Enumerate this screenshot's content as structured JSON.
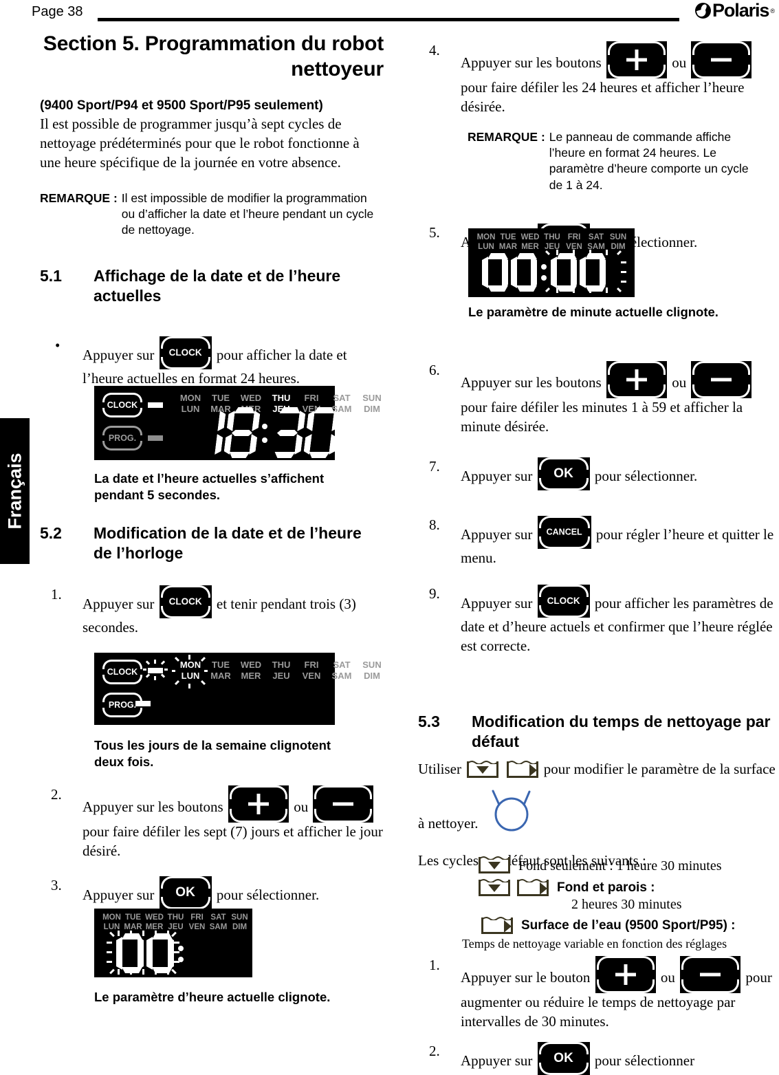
{
  "header": {
    "page_label": "Page 38",
    "brand": "Polaris",
    "brand_reg": "®"
  },
  "side_tab": {
    "label": "Français"
  },
  "left_column": {
    "section_title": "Section 5. Programmation du robot nettoyeur",
    "models_note": "(9400 Sport/P94 et 9500 Sport/P95 seulement)",
    "intro": "Il est possible de programmer jusqu’à sept cycles de nettoyage prédéterminés pour que le robot fonctionne à une heure spécifique de la journée en votre absence.",
    "remark_label": "REMARQUE :",
    "remark_body": "Il est impossible de modifier la programmation ou d’afficher la date et l’heure pendant un cycle de nettoyage.",
    "s51": {
      "number": "5.1",
      "title": "Affichage de la date et de l’heure actuelles",
      "bullet": "•",
      "step_a": "Appuyer sur",
      "step_b": "pour afficher la date et l’heure actuelles en format 24 heures.",
      "caption": "La date et l’heure actuelles s’affichent pendant 5 secondes."
    },
    "s52": {
      "number": "5.2",
      "title": "Modification de la date et de l’heure de l’horloge",
      "step1_num": "1.",
      "step1_a": "Appuyer sur",
      "step1_b": "et tenir pendant trois (3) secondes.",
      "caption1": "Tous les jours de la semaine clignotent deux fois.",
      "step2_num": "2.",
      "step2_a": "Appuyer sur les boutons",
      "step2_or": "ou",
      "step2_b": "pour faire défiler les sept (7) jours et afficher le jour désiré.",
      "step3_num": "3.",
      "step3_a": "Appuyer sur",
      "step3_b": "pour sélectionner.",
      "caption3": "Le paramètre d’heure actuelle clignote."
    }
  },
  "right_column": {
    "step4_num": "4.",
    "step4_a": "Appuyer sur les boutons",
    "step4_or": "ou",
    "step4_b": "pour faire défiler les 24 heures et afficher l’heure désirée.",
    "remark_label": "REMARQUE :",
    "remark_body": "Le panneau de commande affiche l’heure en format 24 heures. Le paramètre d’heure comporte un cycle de 1 à 24.",
    "step5_num": "5.",
    "step5_a": "Appuyer sur",
    "step5_b": "pour sélectionner.",
    "caption5": "Le paramètre de minute actuelle clignote.",
    "step6_num": "6.",
    "step6_a": "Appuyer sur les boutons",
    "step6_or": "ou",
    "step6_b": "pour faire défiler les minutes 1 à 59 et afficher la minute désirée.",
    "step7_num": "7.",
    "step7_a": "Appuyer sur",
    "step7_b": "pour sélectionner.",
    "step8_num": "8.",
    "step8_a": "Appuyer sur",
    "step8_b": "pour régler l’heure et quitter le menu.",
    "step9_num": "9.",
    "step9_a": "Appuyer sur",
    "step9_b": "pour afficher les paramètres de date et d’heure actuels et confirmer que l’heure réglée est correcte.",
    "s53": {
      "number": "5.3",
      "title": "Modification du temps de nettoyage par défaut",
      "use_a": "Utiliser",
      "use_b": "pour modifier le paramètre de la surface",
      "use_c": "à nettoyer.",
      "cycles_lead": "Les cycles par défaut sont les suivants :",
      "cycle1": "Fond seulement : 1 heure 30 minutes",
      "cycle2_title": "Fond et parois :",
      "cycle2_value": "2 heures 30 minutes",
      "cycle3_title": "Surface de l’eau (9500 Sport/P95) :",
      "cycle3_note": "Temps de nettoyage variable en fonction des réglages",
      "step1_num": "1.",
      "step1_a": "Appuyer sur le bouton",
      "step1_or": "ou",
      "step1_b": "pour augmenter ou réduire le temps de nettoyage par intervalles de 30 minutes.",
      "step2_num": "2.",
      "step2_a": "Appuyer sur",
      "step2_b": "pour sélectionner"
    }
  },
  "keys": {
    "clock": "CLOCK",
    "prog": "PROG.",
    "ok": "OK",
    "cancel": "CANCEL",
    "plus": "plus",
    "minus": "minus"
  },
  "lcd": {
    "days_en": [
      "MON",
      "TUE",
      "WED",
      "THU",
      "FRI",
      "SAT",
      "SUN"
    ],
    "days_fr": [
      "LUN",
      "MAR",
      "MER",
      "JEU",
      "VEN",
      "SAM",
      "DIM"
    ],
    "display1": {
      "time": "18:30",
      "active_day": "THU",
      "clock_on": true,
      "prog_on": false
    },
    "display2": {
      "active_day": "MON",
      "blinking": "all-days"
    },
    "display3": {
      "time": "00",
      "blinking": "hours"
    },
    "display4": {
      "time": "00:00",
      "blinking": "minutes"
    }
  },
  "annotation": {
    "type": "blue-circle",
    "color": "#3a66b0"
  }
}
